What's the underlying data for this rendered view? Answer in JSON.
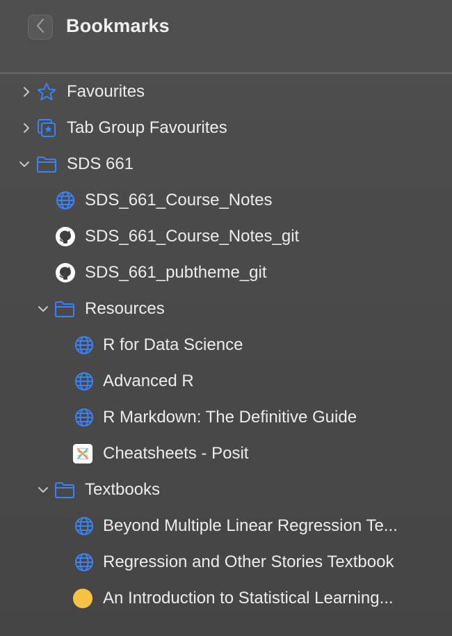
{
  "header": {
    "title": "Bookmarks"
  },
  "bookmarks": {
    "favourites": "Favourites",
    "tab_group_favourites": "Tab Group Favourites",
    "sds_661": "SDS 661",
    "course_notes": "SDS_661_Course_Notes",
    "course_notes_git": "SDS_661_Course_Notes_git",
    "pubtheme_git": "SDS_661_pubtheme_git",
    "resources": "Resources",
    "r4ds": "R for Data Science",
    "advanced_r": "Advanced R",
    "rmarkdown": "R Markdown: The Definitive Guide",
    "cheatsheets": "Cheatsheets - Posit",
    "textbooks": "Textbooks",
    "beyond_mlr": "Beyond Multiple Linear Regression Te...",
    "ros": "Regression and Other Stories Textbook",
    "islr": "An Introduction to Statistical Learning..."
  },
  "colors": {
    "accent": "#3b82f6",
    "islr_dot": "#f5c242"
  }
}
